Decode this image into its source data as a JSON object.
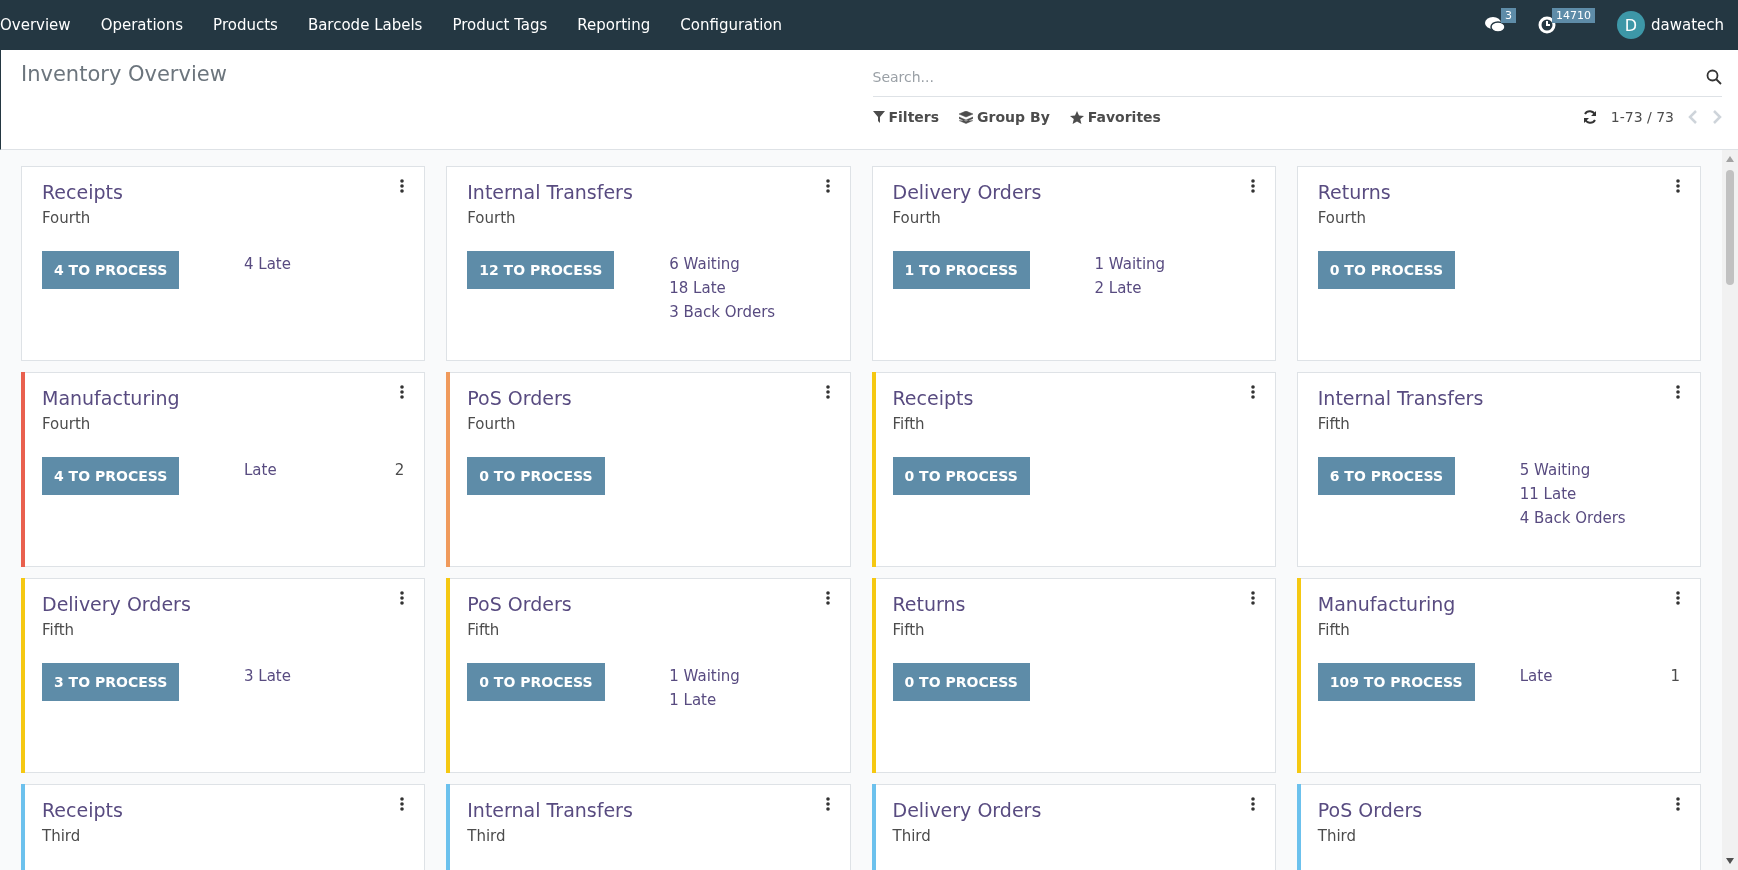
{
  "navbar": {
    "menu": [
      "Overview",
      "Operations",
      "Products",
      "Barcode Labels",
      "Product Tags",
      "Reporting",
      "Configuration"
    ],
    "messages_count": "3",
    "activities_count": "14710",
    "user": {
      "initial": "D",
      "name": "dawatech"
    }
  },
  "control_panel": {
    "title": "Inventory Overview",
    "search": {
      "placeholder": "Search..."
    },
    "filters": [
      "Filters",
      "Group By",
      "Favorites"
    ],
    "pager": "1-73 / 73"
  },
  "cards": [
    {
      "title": "Receipts",
      "warehouse": "Fourth",
      "button": "4 TO PROCESS",
      "stats": [
        {
          "label": "4 Late"
        }
      ]
    },
    {
      "title": "Internal Transfers",
      "warehouse": "Fourth",
      "button": "12 TO PROCESS",
      "stats": [
        {
          "label": "6 Waiting"
        },
        {
          "label": "18 Late"
        },
        {
          "label": "3 Back Orders"
        }
      ]
    },
    {
      "title": "Delivery Orders",
      "warehouse": "Fourth",
      "button": "1 TO PROCESS",
      "stats": [
        {
          "label": "1 Waiting"
        },
        {
          "label": "2 Late"
        }
      ]
    },
    {
      "title": "Returns",
      "warehouse": "Fourth",
      "button": "0 TO PROCESS"
    },
    {
      "title": "Manufacturing",
      "warehouse": "Fourth",
      "color": "#e9604e",
      "button": "4 TO PROCESS",
      "stats": [
        {
          "label": "Late",
          "value": "2"
        }
      ]
    },
    {
      "title": "PoS Orders",
      "warehouse": "Fourth",
      "color": "#f09a5c",
      "button": "0 TO PROCESS"
    },
    {
      "title": "Receipts",
      "warehouse": "Fifth",
      "color": "#f5c812",
      "button": "0 TO PROCESS"
    },
    {
      "title": "Internal Transfers",
      "warehouse": "Fifth",
      "button": "6 TO PROCESS",
      "stats": [
        {
          "label": "5 Waiting"
        },
        {
          "label": "11 Late"
        },
        {
          "label": "4 Back Orders"
        }
      ]
    },
    {
      "title": "Delivery Orders",
      "warehouse": "Fifth",
      "color": "#f5c812",
      "button": "3 TO PROCESS",
      "stats": [
        {
          "label": "3 Late"
        }
      ]
    },
    {
      "title": "PoS Orders",
      "warehouse": "Fifth",
      "color": "#f5c812",
      "button": "0 TO PROCESS",
      "stats": [
        {
          "label": "1 Waiting"
        },
        {
          "label": "1 Late"
        }
      ]
    },
    {
      "title": "Returns",
      "warehouse": "Fifth",
      "color": "#f5c812",
      "button": "0 TO PROCESS"
    },
    {
      "title": "Manufacturing",
      "warehouse": "Fifth",
      "color": "#f5c812",
      "button": "109 TO PROCESS",
      "stats": [
        {
          "label": "Late",
          "value": "1"
        }
      ]
    },
    {
      "title": "Receipts",
      "warehouse": "Third",
      "color": "#6cc1ed"
    },
    {
      "title": "Internal Transfers",
      "warehouse": "Third",
      "color": "#6cc1ed"
    },
    {
      "title": "Delivery Orders",
      "warehouse": "Third",
      "color": "#6cc1ed"
    },
    {
      "title": "PoS Orders",
      "warehouse": "Third",
      "color": "#6cc1ed"
    }
  ]
}
